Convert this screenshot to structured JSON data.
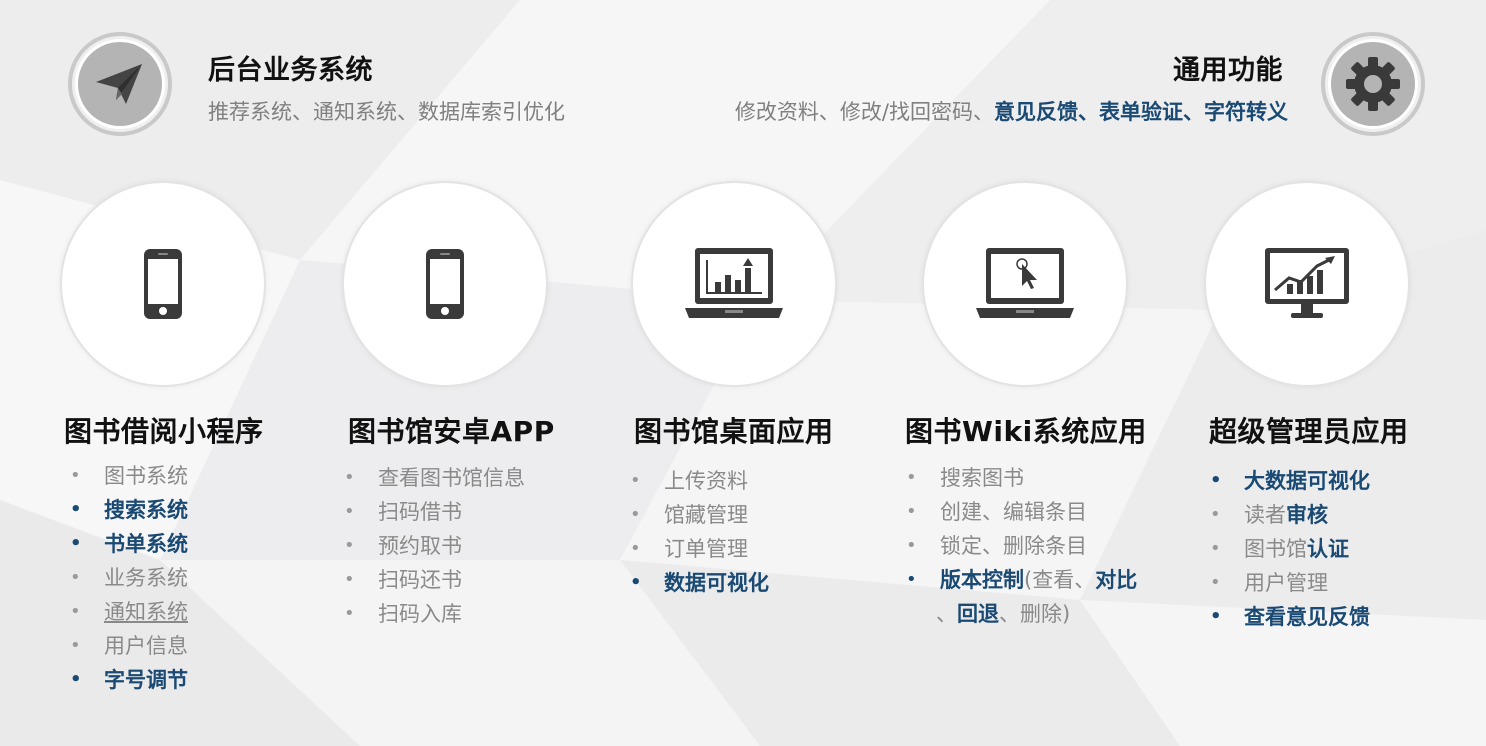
{
  "colors": {
    "accent": "#1a4a73",
    "muted": "#8a8a8a",
    "heading": "#111111"
  },
  "left_feature": {
    "title": "后台业务系统",
    "subtitle": "推荐系统、通知系统、数据库索引优化",
    "icon": "paper-plane-icon"
  },
  "right_feature": {
    "title": "通用功能",
    "subtitle_plain": "修改资料、修改/找回密码、",
    "subtitle_highlight": "意见反馈、表单验证、字符转义",
    "icon": "gear-icon"
  },
  "cards": [
    {
      "title": "图书借阅小程序",
      "icon": "smartphone-icon",
      "items": [
        {
          "text": "图书系统"
        },
        {
          "text": "搜索系统",
          "accent": true
        },
        {
          "text": "书单系统",
          "accent": true
        },
        {
          "text": "业务系统"
        },
        {
          "text": "通知系统",
          "underline": true
        },
        {
          "text": "用户信息"
        },
        {
          "text": "字号调节",
          "accent": true
        }
      ]
    },
    {
      "title": "图书馆安卓APP",
      "icon": "smartphone-icon",
      "items": [
        {
          "text": "查看图书馆信息"
        },
        {
          "text": "扫码借书"
        },
        {
          "text": "预约取书"
        },
        {
          "text": "扫码还书"
        },
        {
          "text": "扫码入库"
        }
      ]
    },
    {
      "title": "图书馆桌面应用",
      "icon": "laptop-chart-icon",
      "items": [
        {
          "text": "上传资料"
        },
        {
          "text": "馆藏管理"
        },
        {
          "text": "订单管理"
        },
        {
          "text": "数据可视化",
          "accent": true
        }
      ]
    },
    {
      "title": "图书Wiki系统应用",
      "icon": "laptop-cursor-icon",
      "items": [
        {
          "text": "搜索图书"
        },
        {
          "text": "创建、编辑条目"
        },
        {
          "text": "锁定、删除条目"
        }
      ],
      "version_item": {
        "a": "版本控制",
        "b": "(查看、",
        "c": "对比",
        "d": "、",
        "e": "回退",
        "f": "、删除)"
      }
    },
    {
      "title": "超级管理员应用",
      "icon": "monitor-growth-chart-icon",
      "items": [
        {
          "text": "大数据可视化",
          "accent": true
        },
        {
          "plain": "读者",
          "bold": "审核"
        },
        {
          "plain": "图书馆",
          "bold": "认证"
        },
        {
          "text": "用户管理"
        },
        {
          "text": "查看意见反馈",
          "accent": true
        }
      ]
    }
  ]
}
